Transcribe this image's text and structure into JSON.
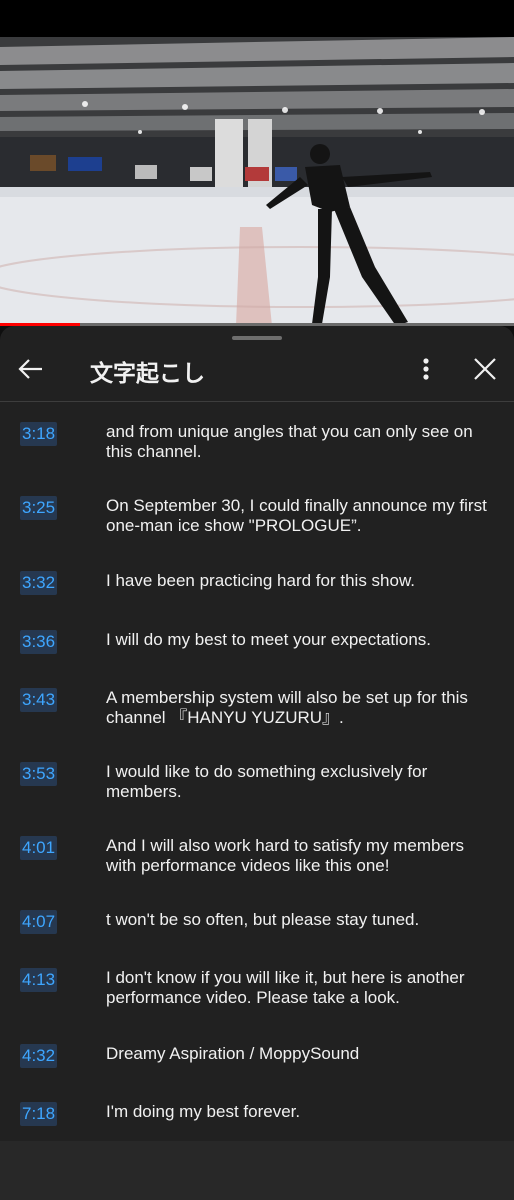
{
  "panel": {
    "title": "文字起こし"
  },
  "video": {
    "progress": 0.155
  },
  "segments": [
    {
      "time": "3:18",
      "text": "and from unique angles that you can only see on this channel."
    },
    {
      "time": "3:25",
      "text": "On September 30, I could finally announce my first one-man ice show \"PROLOGUE”."
    },
    {
      "time": "3:32",
      "text": "I have been practicing hard for this show."
    },
    {
      "time": "3:36",
      "text": "I will do my best to meet your expectations."
    },
    {
      "time": "3:43",
      "text": "A membership system will also be set up for this channel 『HANYU YUZURU』."
    },
    {
      "time": "3:53",
      "text": "I would like to do something exclusively for members."
    },
    {
      "time": "4:01",
      "text": "And I will also work hard to satisfy my members with performance videos like this one!"
    },
    {
      "time": "4:07",
      "text": "t won't be so often, but please stay tuned."
    },
    {
      "time": "4:13",
      "text": "I don't know if you will like it, but here is another performance video. Please take a look."
    },
    {
      "time": "4:32",
      "text": "Dreamy Aspiration / MoppySound"
    },
    {
      "time": "7:18",
      "text": "I'm doing my best forever."
    }
  ],
  "colors": {
    "timestamp_text": "#3ea6ff",
    "timestamp_bg": "#263850",
    "progress": "#ff0000",
    "panel_bg": "#212121"
  },
  "icons": [
    "back-arrow-icon",
    "more-vert-icon",
    "close-icon"
  ]
}
